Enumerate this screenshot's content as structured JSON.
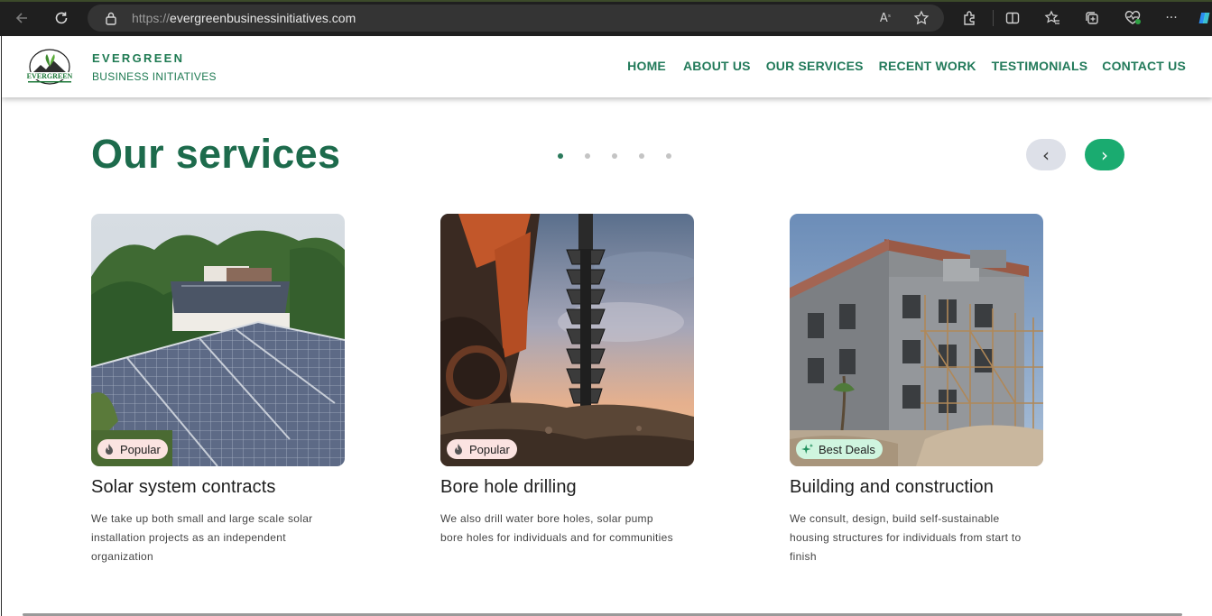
{
  "browser": {
    "url_protocol": "https://",
    "url_host": "evergreenbusinessinitiatives.com",
    "icons": [
      "back-arrow-icon",
      "refresh-icon",
      "lock-icon",
      "read-aloud-icon",
      "favorite-star-icon",
      "extensions-icon",
      "split-screen-icon",
      "favorites-icon",
      "collections-icon",
      "browser-essentials-icon",
      "more-menu-icon",
      "copilot-icon"
    ]
  },
  "header": {
    "brand_name": "EVERGREEN",
    "brand_sub": "BUSINESS INITIATIVES",
    "logo_text": "EVERGREEN",
    "nav": [
      {
        "label": "HOME"
      },
      {
        "label": "ABOUT US"
      },
      {
        "label": "OUR SERVICES"
      },
      {
        "label": "RECENT WORK"
      },
      {
        "label": "TESTIMONIALS"
      },
      {
        "label": "CONTACT US"
      }
    ]
  },
  "services": {
    "title": "Our services",
    "carousel": {
      "pages": 5,
      "active": 1,
      "prev_label": "‹",
      "next_label": "›"
    },
    "cards": [
      {
        "badge": "Popular",
        "badge_icon": "fire-icon",
        "title": "Solar system contracts",
        "description": "We take up both small and large scale solar installation projects as an independent organization"
      },
      {
        "badge": "Popular",
        "badge_icon": "fire-icon",
        "title": "Bore hole drilling",
        "description": "We also drill water bore holes, solar pump bore holes for individuals and for communities"
      },
      {
        "badge": "Best Deals",
        "badge_icon": "sparkle-icon",
        "title": "Building and construction",
        "description": "We consult, design, build self-sustainable housing structures for individuals from start to finish"
      }
    ]
  },
  "colors": {
    "brand_green": "#1e7a52",
    "title_green": "#1d6b4c",
    "next_button": "#1aab70",
    "prev_button": "#dde0e8",
    "badge_popular_bg": "#fbe3e1",
    "badge_deals_bg": "#cff5df"
  }
}
